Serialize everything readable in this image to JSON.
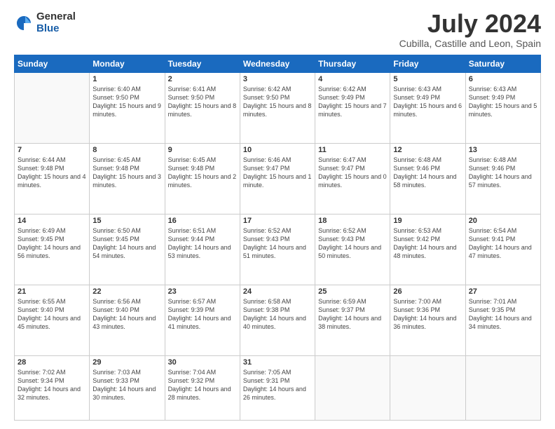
{
  "logo": {
    "general": "General",
    "blue": "Blue"
  },
  "header": {
    "month": "July 2024",
    "location": "Cubilla, Castille and Leon, Spain"
  },
  "weekdays": [
    "Sunday",
    "Monday",
    "Tuesday",
    "Wednesday",
    "Thursday",
    "Friday",
    "Saturday"
  ],
  "weeks": [
    [
      {
        "day": "",
        "sunrise": "",
        "sunset": "",
        "daylight": ""
      },
      {
        "day": "1",
        "sunrise": "Sunrise: 6:40 AM",
        "sunset": "Sunset: 9:50 PM",
        "daylight": "Daylight: 15 hours and 9 minutes."
      },
      {
        "day": "2",
        "sunrise": "Sunrise: 6:41 AM",
        "sunset": "Sunset: 9:50 PM",
        "daylight": "Daylight: 15 hours and 8 minutes."
      },
      {
        "day": "3",
        "sunrise": "Sunrise: 6:42 AM",
        "sunset": "Sunset: 9:50 PM",
        "daylight": "Daylight: 15 hours and 8 minutes."
      },
      {
        "day": "4",
        "sunrise": "Sunrise: 6:42 AM",
        "sunset": "Sunset: 9:49 PM",
        "daylight": "Daylight: 15 hours and 7 minutes."
      },
      {
        "day": "5",
        "sunrise": "Sunrise: 6:43 AM",
        "sunset": "Sunset: 9:49 PM",
        "daylight": "Daylight: 15 hours and 6 minutes."
      },
      {
        "day": "6",
        "sunrise": "Sunrise: 6:43 AM",
        "sunset": "Sunset: 9:49 PM",
        "daylight": "Daylight: 15 hours and 5 minutes."
      }
    ],
    [
      {
        "day": "7",
        "sunrise": "Sunrise: 6:44 AM",
        "sunset": "Sunset: 9:48 PM",
        "daylight": "Daylight: 15 hours and 4 minutes."
      },
      {
        "day": "8",
        "sunrise": "Sunrise: 6:45 AM",
        "sunset": "Sunset: 9:48 PM",
        "daylight": "Daylight: 15 hours and 3 minutes."
      },
      {
        "day": "9",
        "sunrise": "Sunrise: 6:45 AM",
        "sunset": "Sunset: 9:48 PM",
        "daylight": "Daylight: 15 hours and 2 minutes."
      },
      {
        "day": "10",
        "sunrise": "Sunrise: 6:46 AM",
        "sunset": "Sunset: 9:47 PM",
        "daylight": "Daylight: 15 hours and 1 minute."
      },
      {
        "day": "11",
        "sunrise": "Sunrise: 6:47 AM",
        "sunset": "Sunset: 9:47 PM",
        "daylight": "Daylight: 15 hours and 0 minutes."
      },
      {
        "day": "12",
        "sunrise": "Sunrise: 6:48 AM",
        "sunset": "Sunset: 9:46 PM",
        "daylight": "Daylight: 14 hours and 58 minutes."
      },
      {
        "day": "13",
        "sunrise": "Sunrise: 6:48 AM",
        "sunset": "Sunset: 9:46 PM",
        "daylight": "Daylight: 14 hours and 57 minutes."
      }
    ],
    [
      {
        "day": "14",
        "sunrise": "Sunrise: 6:49 AM",
        "sunset": "Sunset: 9:45 PM",
        "daylight": "Daylight: 14 hours and 56 minutes."
      },
      {
        "day": "15",
        "sunrise": "Sunrise: 6:50 AM",
        "sunset": "Sunset: 9:45 PM",
        "daylight": "Daylight: 14 hours and 54 minutes."
      },
      {
        "day": "16",
        "sunrise": "Sunrise: 6:51 AM",
        "sunset": "Sunset: 9:44 PM",
        "daylight": "Daylight: 14 hours and 53 minutes."
      },
      {
        "day": "17",
        "sunrise": "Sunrise: 6:52 AM",
        "sunset": "Sunset: 9:43 PM",
        "daylight": "Daylight: 14 hours and 51 minutes."
      },
      {
        "day": "18",
        "sunrise": "Sunrise: 6:52 AM",
        "sunset": "Sunset: 9:43 PM",
        "daylight": "Daylight: 14 hours and 50 minutes."
      },
      {
        "day": "19",
        "sunrise": "Sunrise: 6:53 AM",
        "sunset": "Sunset: 9:42 PM",
        "daylight": "Daylight: 14 hours and 48 minutes."
      },
      {
        "day": "20",
        "sunrise": "Sunrise: 6:54 AM",
        "sunset": "Sunset: 9:41 PM",
        "daylight": "Daylight: 14 hours and 47 minutes."
      }
    ],
    [
      {
        "day": "21",
        "sunrise": "Sunrise: 6:55 AM",
        "sunset": "Sunset: 9:40 PM",
        "daylight": "Daylight: 14 hours and 45 minutes."
      },
      {
        "day": "22",
        "sunrise": "Sunrise: 6:56 AM",
        "sunset": "Sunset: 9:40 PM",
        "daylight": "Daylight: 14 hours and 43 minutes."
      },
      {
        "day": "23",
        "sunrise": "Sunrise: 6:57 AM",
        "sunset": "Sunset: 9:39 PM",
        "daylight": "Daylight: 14 hours and 41 minutes."
      },
      {
        "day": "24",
        "sunrise": "Sunrise: 6:58 AM",
        "sunset": "Sunset: 9:38 PM",
        "daylight": "Daylight: 14 hours and 40 minutes."
      },
      {
        "day": "25",
        "sunrise": "Sunrise: 6:59 AM",
        "sunset": "Sunset: 9:37 PM",
        "daylight": "Daylight: 14 hours and 38 minutes."
      },
      {
        "day": "26",
        "sunrise": "Sunrise: 7:00 AM",
        "sunset": "Sunset: 9:36 PM",
        "daylight": "Daylight: 14 hours and 36 minutes."
      },
      {
        "day": "27",
        "sunrise": "Sunrise: 7:01 AM",
        "sunset": "Sunset: 9:35 PM",
        "daylight": "Daylight: 14 hours and 34 minutes."
      }
    ],
    [
      {
        "day": "28",
        "sunrise": "Sunrise: 7:02 AM",
        "sunset": "Sunset: 9:34 PM",
        "daylight": "Daylight: 14 hours and 32 minutes."
      },
      {
        "day": "29",
        "sunrise": "Sunrise: 7:03 AM",
        "sunset": "Sunset: 9:33 PM",
        "daylight": "Daylight: 14 hours and 30 minutes."
      },
      {
        "day": "30",
        "sunrise": "Sunrise: 7:04 AM",
        "sunset": "Sunset: 9:32 PM",
        "daylight": "Daylight: 14 hours and 28 minutes."
      },
      {
        "day": "31",
        "sunrise": "Sunrise: 7:05 AM",
        "sunset": "Sunset: 9:31 PM",
        "daylight": "Daylight: 14 hours and 26 minutes."
      },
      {
        "day": "",
        "sunrise": "",
        "sunset": "",
        "daylight": ""
      },
      {
        "day": "",
        "sunrise": "",
        "sunset": "",
        "daylight": ""
      },
      {
        "day": "",
        "sunrise": "",
        "sunset": "",
        "daylight": ""
      }
    ]
  ]
}
